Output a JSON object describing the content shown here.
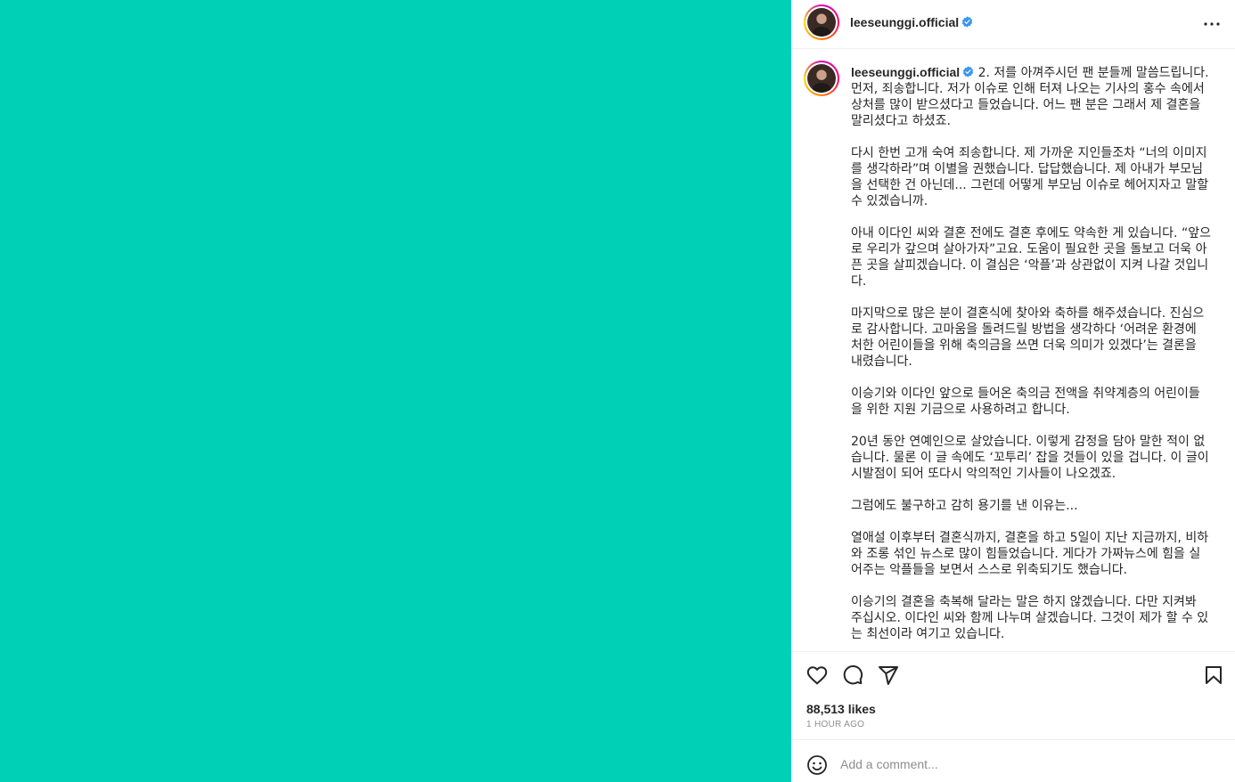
{
  "media": {
    "background_color": "#00d0b6"
  },
  "post": {
    "username": "leeseunggi.official",
    "verified": true,
    "caption_paragraphs": [
      "2. 저를 아껴주시던 팬 분들께 말씀드립니다. 먼저, 죄송합니다. 저가 이슈로 인해 터져 나오는 기사의 홍수 속에서 상처를 많이 받으셨다고 들었습니다. 어느 팬 분은 그래서 제 결혼을 말리셨다고 하셨죠.",
      "다시 한번 고개 숙여 죄송합니다. 제 가까운 지인들조차 “너의 이미지를 생각하라”며 이별을 권했습니다. 답답했습니다. 제 아내가 부모님을 선택한 건 아닌데... 그런데 어떻게 부모님 이슈로 헤어지자고 말할 수 있겠습니까.",
      "아내 이다인 씨와 결혼 전에도 결혼 후에도 약속한 게 있습니다. “앞으로 우리가 갚으며 살아가자”고요. 도움이 필요한 곳을 돌보고 더욱 아픈 곳을 살피겠습니다. 이 결심은 ‘악플’과 상관없이 지켜 나갈 것입니다.",
      "마지막으로 많은 분이 결혼식에 찾아와 축하를 해주셨습니다. 진심으로 감사합니다. 고마움을 돌려드릴 방법을 생각하다 ‘어려운 환경에 처한 어린이들을 위해 축의금을 쓰면 더욱 의미가 있겠다’는 결론을 내렸습니다.",
      "이승기와 이다인 앞으로 들어온 축의금 전액을 취약계층의 어린이들을 위한 지원 기금으로 사용하려고 합니다.",
      "20년 동안 연예인으로 살았습니다. 이렇게 감정을 담아 말한 적이 없습니다. 물론 이 글 속에도 ‘꼬투리’ 잡을 것들이 있을 겁니다. 이 글이 시발점이 되어 또다시 악의적인 기사들이 나오겠죠.",
      "그럼에도 불구하고 감히 용기를 낸 이유는...",
      "열애설 이후부터 결혼식까지, 결혼을 하고 5일이 지난 지금까지, 비하와 조롱 섞인 뉴스로 많이 힘들었습니다. 게다가 가짜뉴스에 힘을 실어주는 악플들을 보면서 스스로 위축되기도 했습니다.",
      "이승기의 결혼을 축복해 달라는 말은 하지 않겠습니다. 다만 지켜봐 주십시오. 이다인 씨와 함께 나누며 살겠습니다. 그것이 제가 할 수 있는 최선이라 여기고 있습니다."
    ],
    "likes": "88,513 likes",
    "time": "1 HOUR AGO"
  },
  "comment": {
    "placeholder": "Add a comment..."
  },
  "icons": {
    "more": "more-options-icon",
    "like": "heart-icon",
    "comment": "comment-bubble-icon",
    "share": "paper-plane-icon",
    "save": "bookmark-icon",
    "emoji": "emoji-smile-icon",
    "verified": "verified-badge-icon"
  },
  "colors": {
    "verified_blue": "#3897f0",
    "muted": "#8e8e8e",
    "border": "#efefef"
  }
}
